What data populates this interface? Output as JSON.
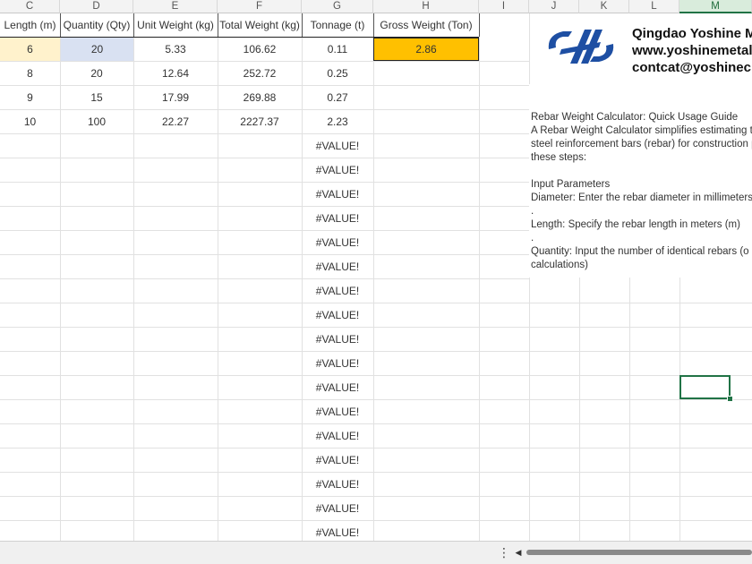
{
  "columns": [
    "C",
    "D",
    "E",
    "F",
    "G",
    "H",
    "I",
    "J",
    "K",
    "L",
    "M"
  ],
  "selected_column": "M",
  "table": {
    "headers": [
      "Length (m)",
      "Quantity (Qty)",
      "Unit Weight (kg)",
      "Total Weight (kg)",
      "Tonnage (t)",
      "Gross Weight (Ton)"
    ],
    "rows": [
      [
        "6",
        "20",
        "5.33",
        "106.62",
        "0.11"
      ],
      [
        "8",
        "20",
        "12.64",
        "252.72",
        "0.25"
      ],
      [
        "9",
        "15",
        "17.99",
        "269.88",
        "0.27"
      ],
      [
        "10",
        "100",
        "22.27",
        "2227.37",
        "2.23"
      ]
    ],
    "gross_weight": "2.86",
    "error_value": "#VALUE!"
  },
  "company": {
    "name": "Qingdao Yoshine M",
    "website": "www.yoshinemetal.",
    "email": "contcat@yoshinecn"
  },
  "guide": {
    "title": "Rebar Weight Calculator: Quick Usage Guide",
    "line1": "A Rebar Weight Calculator simplifies estimating t",
    "line2": "steel reinforcement bars (rebar) for construction p",
    "line3": "these steps:",
    "section": "Input Parameters",
    "diameter": "Diameter: Enter the rebar diameter in millimeters",
    "dot1": ".",
    "length": "Length: Specify the rebar length in meters (m)",
    "dot2": ".",
    "quantity": "Quantity: Input the number of identical rebars (o",
    "quantity_cont": "calculations)"
  },
  "icons": {
    "logo": "yoshine-logo-icon",
    "scroll_left": "triangle-left-icon",
    "more": "vertical-dots-icon"
  },
  "colors": {
    "gross_fill": "#ffc000",
    "length_fill": "#fff2cc",
    "quantity_fill": "#d9e1f2",
    "selection": "#217346",
    "logo_blue": "#1e4fa3"
  }
}
